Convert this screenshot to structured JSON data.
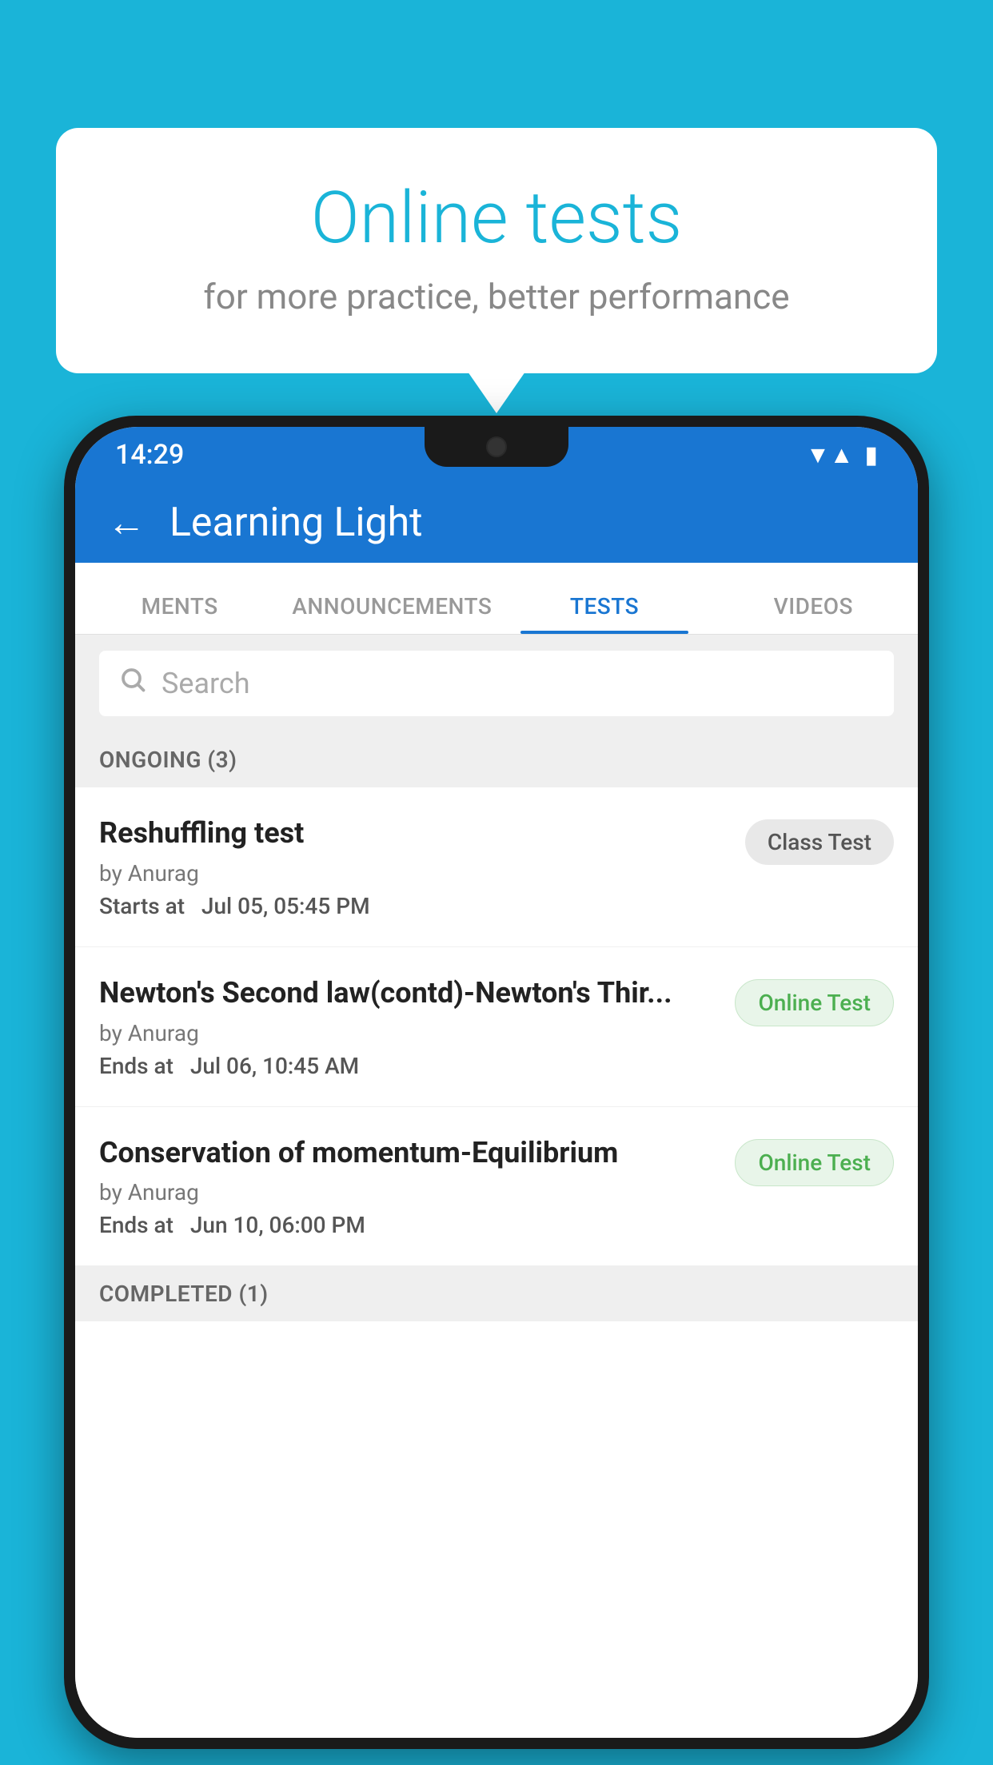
{
  "background": {
    "color": "#1ab4d8"
  },
  "bubble": {
    "title": "Online tests",
    "subtitle": "for more practice, better performance"
  },
  "phone": {
    "status_bar": {
      "time": "14:29",
      "wifi": "▼",
      "signal": "▲",
      "battery": "▮"
    },
    "app_bar": {
      "back_label": "←",
      "title": "Learning Light"
    },
    "tabs": [
      {
        "label": "MENTS",
        "active": false
      },
      {
        "label": "ANNOUNCEMENTS",
        "active": false
      },
      {
        "label": "TESTS",
        "active": true
      },
      {
        "label": "VIDEOS",
        "active": false
      }
    ],
    "search": {
      "placeholder": "Search"
    },
    "section_ongoing": {
      "label": "ONGOING (3)"
    },
    "tests": [
      {
        "name": "Reshuffling test",
        "by": "by Anurag",
        "date_label": "Starts at",
        "date": "Jul 05, 05:45 PM",
        "badge": "Class Test",
        "badge_type": "class"
      },
      {
        "name": "Newton's Second law(contd)-Newton's Thir...",
        "by": "by Anurag",
        "date_label": "Ends at",
        "date": "Jul 06, 10:45 AM",
        "badge": "Online Test",
        "badge_type": "online"
      },
      {
        "name": "Conservation of momentum-Equilibrium",
        "by": "by Anurag",
        "date_label": "Ends at",
        "date": "Jun 10, 06:00 PM",
        "badge": "Online Test",
        "badge_type": "online"
      }
    ],
    "section_completed": {
      "label": "COMPLETED (1)"
    }
  }
}
